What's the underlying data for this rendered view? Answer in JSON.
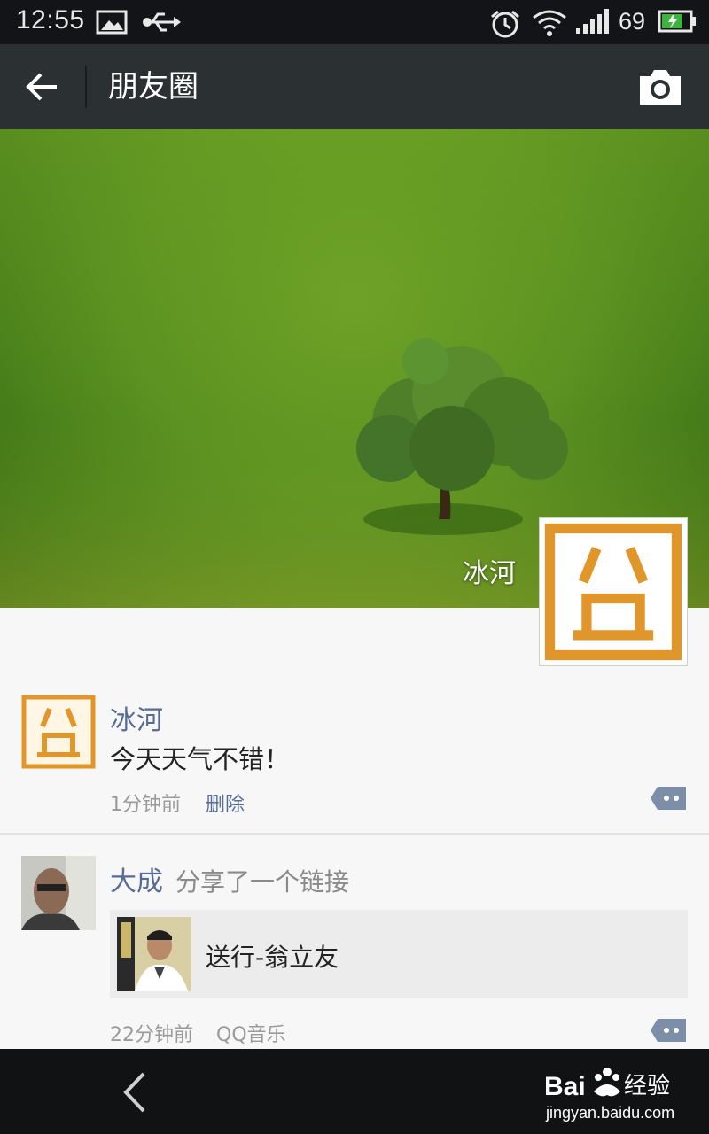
{
  "status_bar": {
    "time": "12:55",
    "battery_level": "69",
    "icons": [
      "image-icon",
      "usb-icon",
      "alarm-icon",
      "wifi-icon",
      "signal-icon",
      "battery-icon"
    ]
  },
  "header": {
    "title": "朋友圈",
    "back_icon": "back-arrow-icon",
    "camera_icon": "camera-icon"
  },
  "cover": {
    "user_name": "冰河"
  },
  "posts": [
    {
      "author": "冰河",
      "content": "今天天气不错！",
      "time": "1分钟前",
      "delete_label": "删除"
    },
    {
      "author": "大成",
      "action": "分享了一个链接",
      "link_title": "送行-翁立友",
      "time": "22分钟前",
      "source": "QQ音乐"
    }
  ],
  "watermark": {
    "brand_left": "Bai",
    "brand_right": "经验",
    "url": "jingyan.baidu.com"
  },
  "colors": {
    "link_blue": "#576b95",
    "title_bar": "#2b3033",
    "avatar_orange": "#e0962a"
  }
}
